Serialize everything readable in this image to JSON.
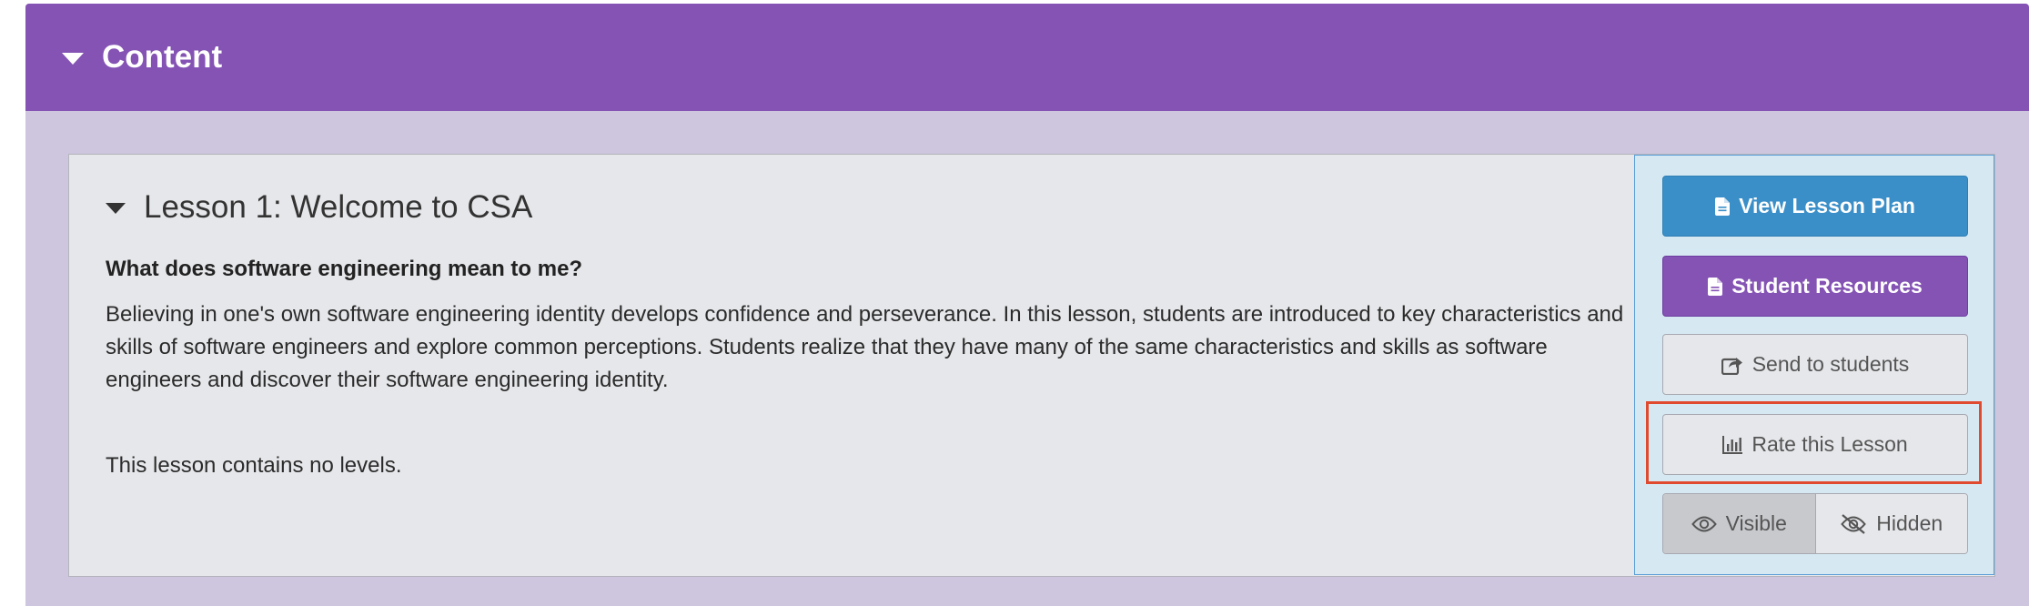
{
  "section": {
    "title": "Content"
  },
  "lesson": {
    "title": "Lesson 1: Welcome to CSA",
    "question": "What does software engineering mean to me?",
    "description": "Believing in one's own software engineering identity develops confidence and perseverance. In this lesson, students are introduced to key characteristics and skills of software engineers and explore common perceptions. Students realize that they have many of the same characteristics and skills as software engineers and discover their software engineering identity.",
    "levels_note": "This lesson contains no levels."
  },
  "actions": {
    "view_plan": {
      "label": "View Lesson Plan",
      "icon": "document-icon"
    },
    "student_resources": {
      "label": "Student Resources",
      "icon": "document-icon"
    },
    "send_to_students": {
      "label": "Send to students",
      "icon": "share-icon"
    },
    "rate_lesson": {
      "label": "Rate this Lesson",
      "icon": "bar-chart-icon"
    }
  },
  "visibility": {
    "visible_label": "Visible",
    "hidden_label": "Hidden",
    "selected": "Visible"
  },
  "colors": {
    "header": "#8453b4",
    "section_bg": "#cdc6de",
    "primary_button": "#3b8fc8",
    "secondary_button": "#8453b4",
    "highlight": "#e04a2f"
  }
}
